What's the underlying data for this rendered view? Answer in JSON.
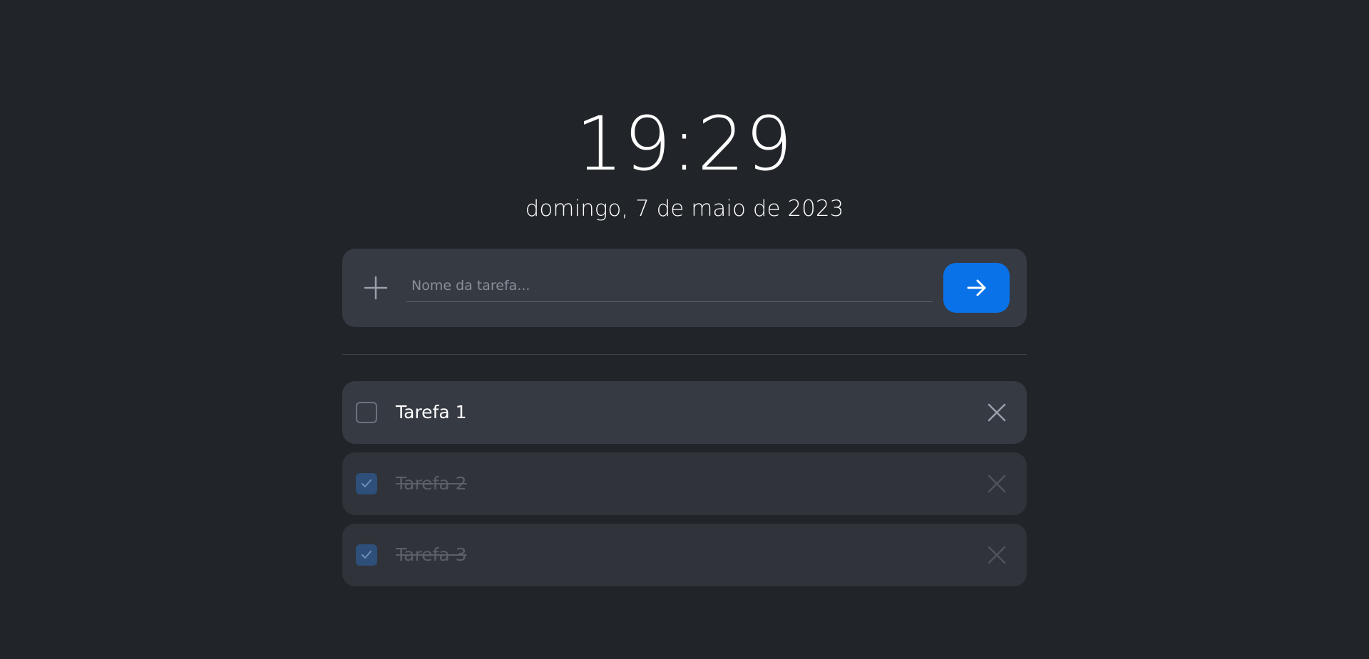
{
  "clock": {
    "time": "19:29",
    "date": "domingo, 7 de maio de 2023"
  },
  "new_task": {
    "value": "",
    "placeholder": "Nome da tarefa...",
    "add_icon": "plus-icon",
    "submit_icon": "arrow-right-icon"
  },
  "tasks": [
    {
      "label": "Tarefa 1",
      "done": false
    },
    {
      "label": "Tarefa 2",
      "done": true
    },
    {
      "label": "Tarefa 3",
      "done": true
    }
  ],
  "colors": {
    "background": "#212429",
    "panel": "#363a42",
    "accent": "#0a72e8",
    "checked": "#2d4f7a"
  }
}
